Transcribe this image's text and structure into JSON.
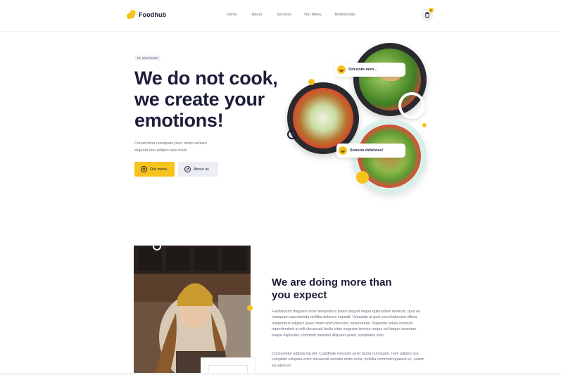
{
  "brand": {
    "name": "Foodhub",
    "accent": "#f6c21c",
    "dark": "#1c1c3a"
  },
  "nav": {
    "items": [
      "Home",
      "About",
      "Services",
      "Our Menu",
      "Testimonials"
    ],
    "cart_icon": "shopping-bag-icon",
    "cart_count": "0"
  },
  "hero": {
    "greeting": "Hi, new friend!",
    "title": "We do not cook,\nwe create your\nemotions!",
    "subtitle": "Consectetur numquam poro nemo veniam\neligendi rem adipisci quo modi",
    "primary_button": "Our menu",
    "secondary_button": "About us",
    "bubble_top": "Om-nom-nom...",
    "bubble_bottom": "Sooooo delicious!"
  },
  "about": {
    "title": "We are doing more than\nyou expect",
    "paragraph1": "Faudantium magnam error temporibus ipsam aliquid neque quibusdam dolorum, quia ea numquam assumenda mollitia dolorem impedit. Voluptate at quis exercitationem officia temporibus adipisci quae totam enim dolorum, assumenda. Sapiente soluta nostrum reprehenderit a velit obcaecati facilis vitae magnam tenetur neque vel itaque inventore eaque explicabo commodi maxime! Aliquam quasi, voluptates odio.",
    "paragraph2": "Consectetur adipisicing elit. Cupiditate nesciunt amet facilis numquam, nam adipisci qui voluptate voluptas enim obcaecati veritatis animi nulla, mollitia commodi quaerat ex, autem ea laborum."
  }
}
